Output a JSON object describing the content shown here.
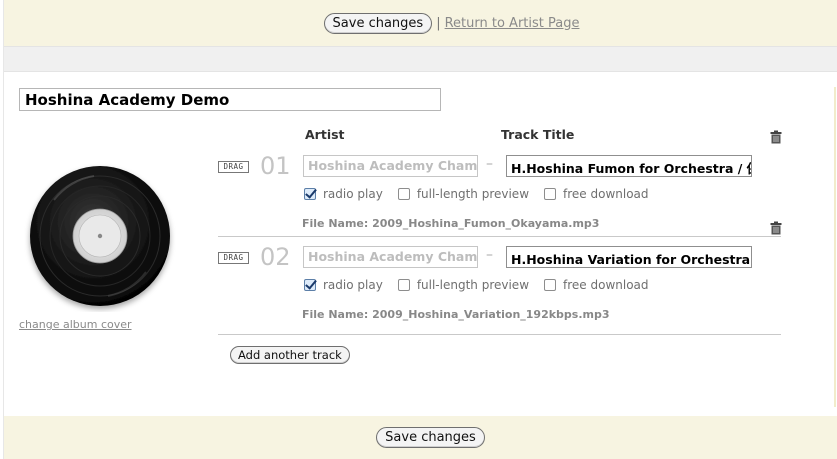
{
  "header": {
    "save_label": "Save changes",
    "separator": "|",
    "return_link": "Return to Artist Page"
  },
  "album": {
    "title": "Hoshina Academy Demo",
    "change_cover_link": "change album cover"
  },
  "columns": {
    "artist": "Artist",
    "track_title": "Track Title"
  },
  "tracks": [
    {
      "drag_label": "DRAG",
      "number": "01",
      "artist": "Hoshina Academy Chamber",
      "dash": "–",
      "title": "H.Hoshina Fumon for Orchestra / 保科洋",
      "options": [
        {
          "label": "radio play",
          "checked": true
        },
        {
          "label": "full-length preview",
          "checked": false
        },
        {
          "label": "free download",
          "checked": false
        }
      ],
      "file_name": "File Name: 2009_Hoshina_Fumon_Okayama.mp3"
    },
    {
      "drag_label": "DRAG",
      "number": "02",
      "artist": "Hoshina Academy Chamber",
      "dash": "–",
      "title": "H.Hoshina Variation for Orchestra / 保科洋",
      "options": [
        {
          "label": "radio play",
          "checked": true
        },
        {
          "label": "full-length preview",
          "checked": false
        },
        {
          "label": "free download",
          "checked": false
        }
      ],
      "file_name": "File Name: 2009_Hoshina_Variation_192kbps.mp3"
    }
  ],
  "actions": {
    "add_track_label": "Add another track",
    "save_label": "Save changes"
  },
  "icons": {
    "delete": "trash-icon",
    "cover": "vinyl-record-icon"
  },
  "colors": {
    "bar_background": "#f7f4e1",
    "band_gray": "#f0f0f0",
    "link_gray": "#8a8a8a"
  }
}
